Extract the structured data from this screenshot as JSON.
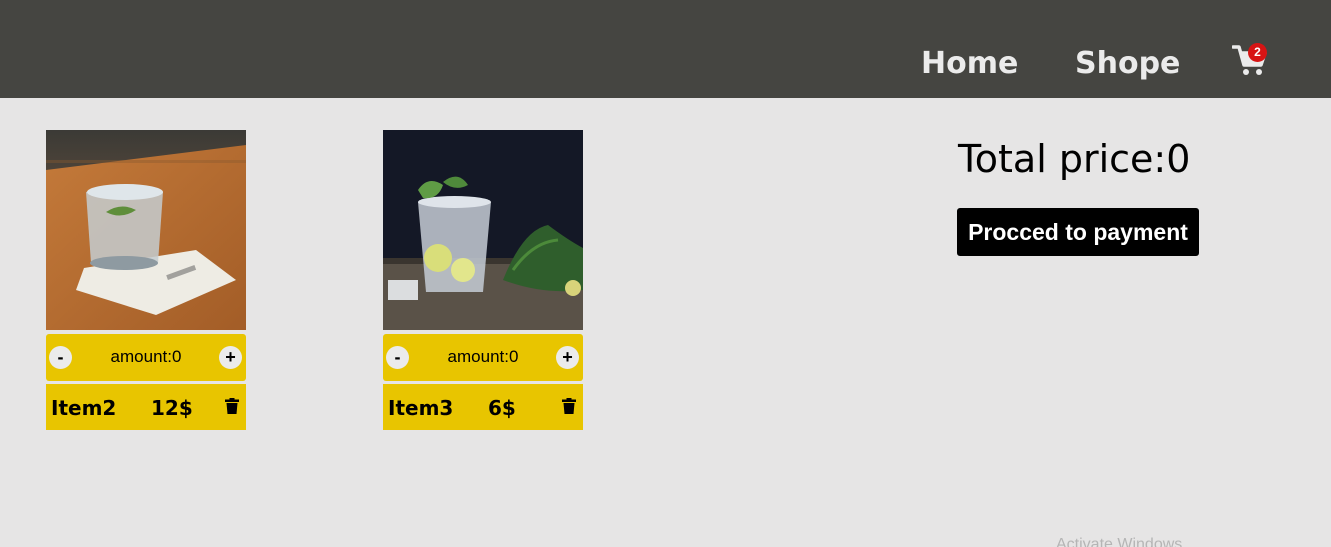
{
  "nav": {
    "home_label": "Home",
    "shop_label": "Shope",
    "cart_icon": "cart-icon",
    "cart_count": "2"
  },
  "cart_items": [
    {
      "image": "water-glass-photo",
      "minus_label": "-",
      "amount_text": "amount:0",
      "plus_label": "+",
      "name": "Item2",
      "price": "12$",
      "delete_icon": "trash-icon"
    },
    {
      "image": "mojito-glass-photo",
      "minus_label": "-",
      "amount_text": "amount:0",
      "plus_label": "+",
      "name": "Item3",
      "price": "6$",
      "delete_icon": "trash-icon"
    }
  ],
  "summary": {
    "total_text": "Total price:0",
    "pay_button_label": "Procced to payment"
  },
  "watermark": "Activate Windows",
  "colors": {
    "navbar": "#454541",
    "background": "#e6e5e5",
    "card_accent": "#e8c500",
    "badge": "#d71414",
    "button": "#000000"
  }
}
